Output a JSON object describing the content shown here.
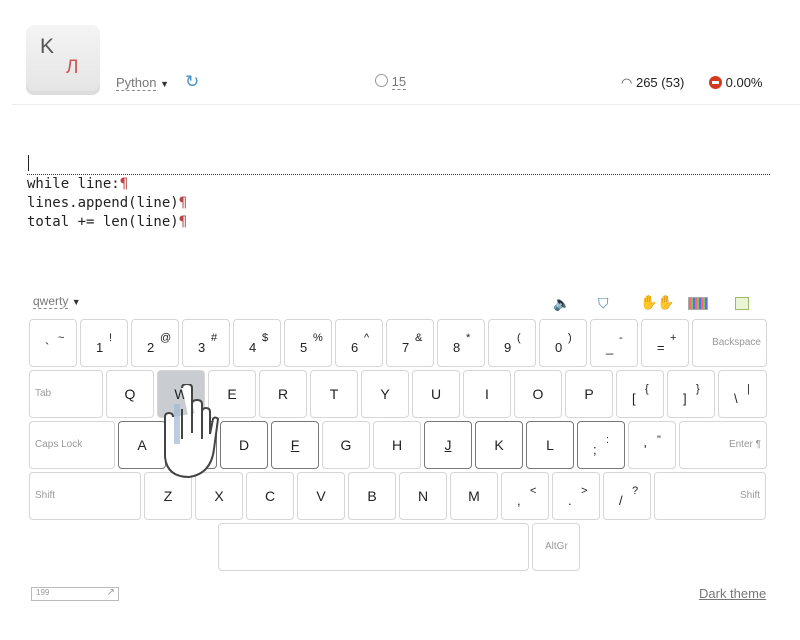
{
  "header": {
    "logo": {
      "latin": "K",
      "cyrillic": "Л"
    },
    "language": "Python",
    "timer": "15",
    "speed": "265 (53)",
    "errors": "0.00%"
  },
  "text": {
    "lines": [
      "while line:",
      "lines.append(line)",
      "total += len(line)"
    ],
    "pilcrow": "¶"
  },
  "keyboard": {
    "layout": "qwerty",
    "tools": [
      "sound-icon",
      "ink-icon",
      "hands-icon",
      "keyboard-color-icon",
      "exit-icon"
    ],
    "rows": [
      [
        [
          "`",
          "~"
        ],
        [
          "1",
          "!"
        ],
        [
          "2",
          "@"
        ],
        [
          "3",
          "#"
        ],
        [
          "4",
          "$"
        ],
        [
          "5",
          "%"
        ],
        [
          "6",
          "^"
        ],
        [
          "7",
          "&"
        ],
        [
          "8",
          "*"
        ],
        [
          "9",
          "("
        ],
        [
          "0",
          ")"
        ],
        [
          "_",
          "-"
        ],
        [
          "=",
          "+"
        ],
        [
          "Backspace"
        ]
      ],
      [
        [
          "Tab"
        ],
        [
          "Q"
        ],
        [
          "W"
        ],
        [
          "E"
        ],
        [
          "R"
        ],
        [
          "T"
        ],
        [
          "Y"
        ],
        [
          "U"
        ],
        [
          "I"
        ],
        [
          "O"
        ],
        [
          "P"
        ],
        [
          "[",
          "{"
        ],
        [
          "]",
          "}"
        ],
        [
          "\\",
          "|"
        ]
      ],
      [
        [
          "Caps Lock"
        ],
        [
          "A"
        ],
        [
          "S"
        ],
        [
          "D"
        ],
        [
          "F"
        ],
        [
          "G"
        ],
        [
          "H"
        ],
        [
          "J"
        ],
        [
          "K"
        ],
        [
          "L"
        ],
        [
          ";",
          ":"
        ],
        [
          "'",
          "\""
        ],
        [
          "Enter ¶"
        ]
      ],
      [
        [
          "Shift"
        ],
        [
          "Z"
        ],
        [
          "X"
        ],
        [
          "C"
        ],
        [
          "V"
        ],
        [
          "B"
        ],
        [
          "N"
        ],
        [
          "M"
        ],
        [
          ",",
          "<"
        ],
        [
          ".",
          ">"
        ],
        [
          "/",
          "?"
        ],
        [
          "Shift"
        ]
      ],
      [
        [
          ""
        ],
        [
          "AltGr"
        ]
      ]
    ],
    "active_key": "W",
    "home_keys": [
      "A",
      "S",
      "D",
      "F",
      "J",
      "K",
      "L",
      ";"
    ]
  },
  "footer": {
    "counter": "199",
    "theme_link": "Dark theme"
  }
}
